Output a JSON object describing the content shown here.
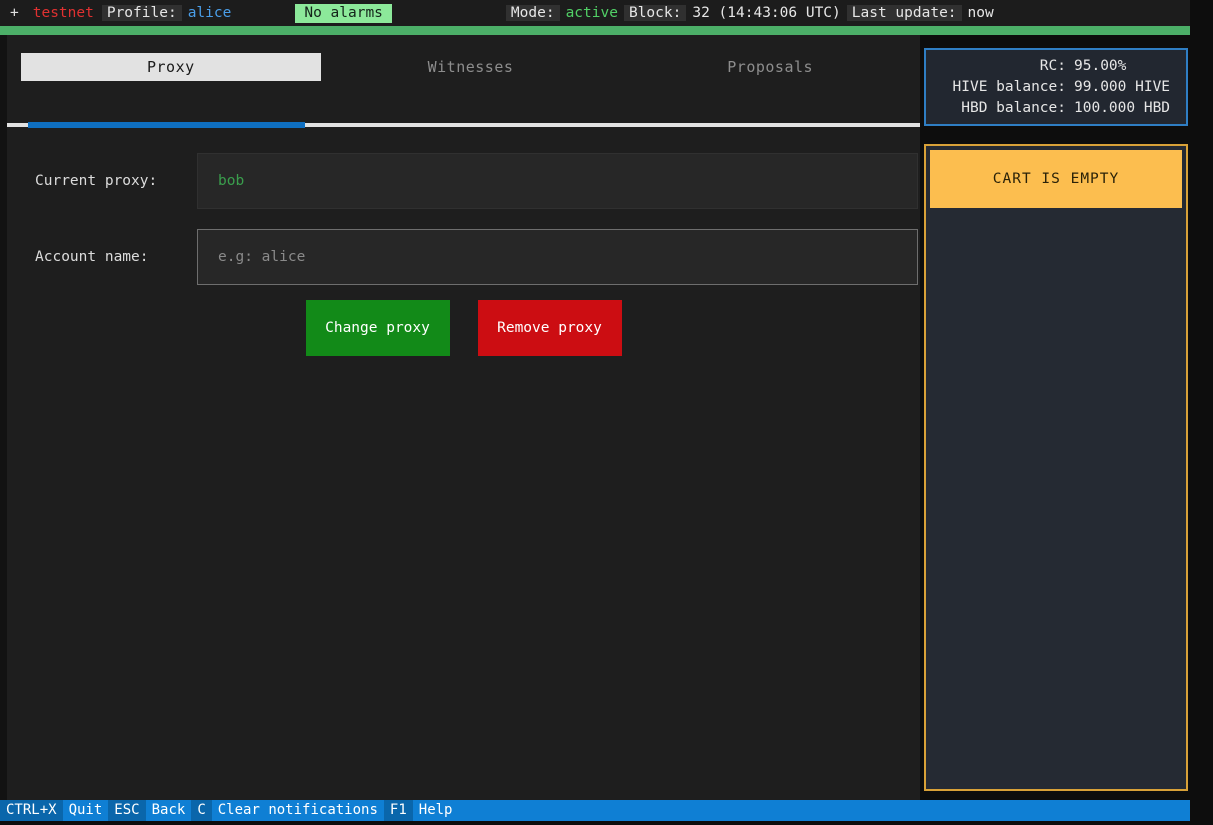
{
  "header": {
    "plus_glyph": "+",
    "network": "testnet",
    "profile_label": "Profile:",
    "profile_name": "alice",
    "alarm_badge": "No alarms",
    "mode_label": "Mode:",
    "mode_value": "active",
    "block_label": "Block:",
    "block_value": "32 (14:43:06 UTC)",
    "last_update_label": "Last update:",
    "last_update_value": "now",
    "accent_red": "#e03131",
    "accent_blue": "#4a9ee8",
    "accent_green": "#51cf66",
    "alarm_bg": "#8ce99a",
    "status_bar_color": "#4caf68"
  },
  "tabs": [
    {
      "label": "Proxy",
      "active": true
    },
    {
      "label": "Witnesses",
      "active": false
    },
    {
      "label": "Proposals",
      "active": false
    }
  ],
  "tab_accent": "#0f6fc0",
  "form": {
    "current_proxy": {
      "label": "Current proxy:",
      "value": "bob",
      "value_color": "#3a9e4d"
    },
    "account_name": {
      "label": "Account name:",
      "value": "",
      "placeholder": "e.g: alice"
    }
  },
  "buttons": {
    "change_proxy": {
      "label": "Change proxy",
      "color": "#128a18"
    },
    "remove_proxy": {
      "label": "Remove proxy",
      "color": "#cc0d12"
    }
  },
  "sidebar": {
    "balances": {
      "border_color": "#2f7ec4",
      "rows": [
        {
          "key": "RC:",
          "value": "95.00%"
        },
        {
          "key": "HIVE balance:",
          "value": "99.000 HIVE"
        },
        {
          "key": "HBD balance:",
          "value": "100.000 HBD"
        }
      ]
    },
    "cart": {
      "title": "CART IS EMPTY",
      "border_color": "#d8a138",
      "header_bg": "#fcbe4f"
    }
  },
  "footer": {
    "bg": "#0f7fd4",
    "items": [
      {
        "key": "CTRL+X",
        "desc": "Quit"
      },
      {
        "key": "ESC",
        "desc": "Back"
      },
      {
        "key": "C",
        "desc": "Clear notifications"
      },
      {
        "key": "F1",
        "desc": "Help"
      }
    ]
  }
}
